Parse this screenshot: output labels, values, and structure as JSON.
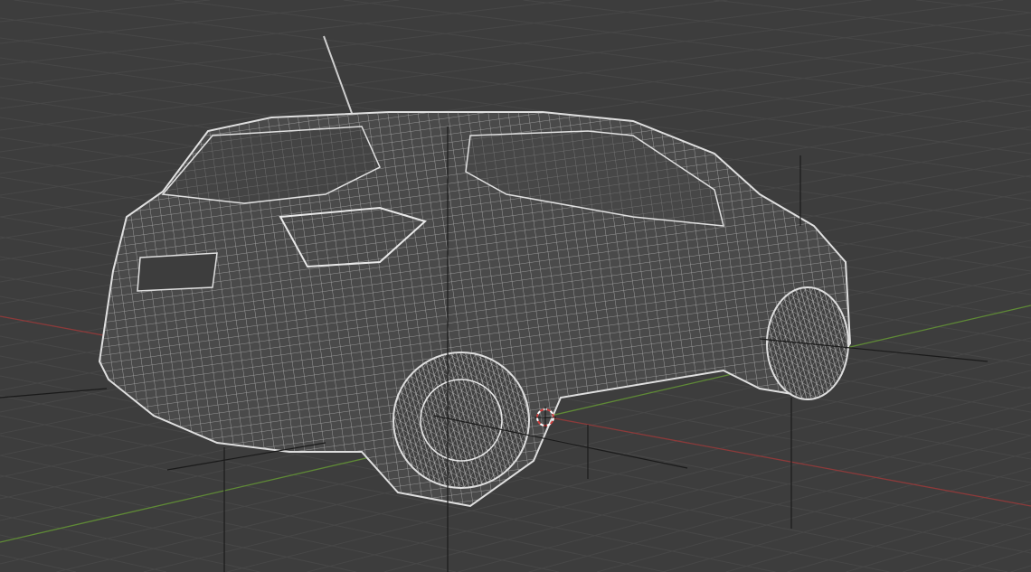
{
  "viewport": {
    "mode": "wireframe",
    "object": "car",
    "colors": {
      "background": "#3d3d3d",
      "grid": "#4a4a4a",
      "x_axis": "#9a3c3c",
      "y_axis": "#6a9a3a",
      "wire": "#d8d8d8",
      "cursor": "#d04040"
    },
    "icons": [
      "3d-cursor-icon",
      "empty-axes-icon"
    ]
  }
}
